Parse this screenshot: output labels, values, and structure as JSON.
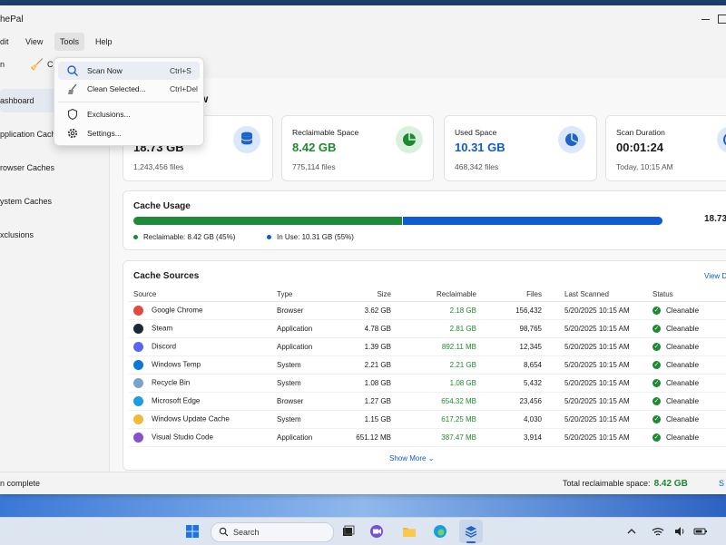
{
  "window": {
    "title": "hePal"
  },
  "menu": [
    {
      "label": "dit",
      "x": 0
    },
    {
      "label": "View",
      "x": 22
    },
    {
      "label": "Tools",
      "x": 60
    },
    {
      "label": "Help",
      "x": 99
    }
  ],
  "toolbar": {
    "item1": "n",
    "item2": "C"
  },
  "sidebar": [
    {
      "label": "ashboard",
      "active": true
    },
    {
      "label": "pplication Cache",
      "active": false
    },
    {
      "label": "rowser Caches",
      "active": false
    },
    {
      "label": "ystem Caches",
      "active": false
    },
    {
      "label": "xclusions",
      "active": false
    }
  ],
  "page_title": "w",
  "stats": [
    {
      "label": "",
      "value": "18.73 GB",
      "sub": "1,243,456 files",
      "color": "#1b1b1b",
      "icon": "database-icon"
    },
    {
      "label": "Reclaimable Space",
      "value": "8.42 GB",
      "sub": "775,114 files",
      "color": "#1c8a2f",
      "icon": "pie-chart-icon"
    },
    {
      "label": "Used Space",
      "value": "10.31 GB",
      "sub": "468,342 files",
      "color": "#0a5cd4",
      "icon": "pie-chart-icon"
    },
    {
      "label": "Scan Duration",
      "value": "00:01:24",
      "sub": "Today, 10:15 AM",
      "color": "#1b1b1b",
      "icon": "clock-icon"
    }
  ],
  "usage": {
    "title": "Cache Usage",
    "total": "18.73",
    "reclaimable_legend": "Reclaimable: 8.42 GB (45%)",
    "inuse_legend": "In Use: 10.31 GB (55%)",
    "reclaimable_fraction": 0.45
  },
  "sources": {
    "title": "Cache Sources",
    "view_details": "View D",
    "show_more": "Show More",
    "columns": [
      "Source",
      "Type",
      "Size",
      "Reclaimable",
      "Files",
      "Last Scanned",
      "Status"
    ],
    "rows": [
      {
        "source": "Google Chrome",
        "type": "Browser",
        "size": "3.62 GB",
        "reclaimable": "2.18 GB",
        "files": "156,432",
        "scanned": "5/20/2025 10:15 AM",
        "status": "Cleanable",
        "icon": "chrome-icon",
        "color": "#e24a3b"
      },
      {
        "source": "Steam",
        "type": "Application",
        "size": "4.78 GB",
        "reclaimable": "2.81 GB",
        "files": "98,765",
        "scanned": "5/20/2025 10:15 AM",
        "status": "Cleanable",
        "icon": "steam-icon",
        "color": "#1b2838"
      },
      {
        "source": "Discord",
        "type": "Application",
        "size": "1.39 GB",
        "reclaimable": "892.11 MB",
        "files": "12,345",
        "scanned": "5/20/2025 10:15 AM",
        "status": "Cleanable",
        "icon": "discord-icon",
        "color": "#5865f2"
      },
      {
        "source": "Windows Temp",
        "type": "System",
        "size": "2.21 GB",
        "reclaimable": "2.21 GB",
        "files": "8,654",
        "scanned": "5/20/2025 10:15 AM",
        "status": "Cleanable",
        "icon": "windows-icon",
        "color": "#0a78d7"
      },
      {
        "source": "Recycle Bin",
        "type": "System",
        "size": "1.08 GB",
        "reclaimable": "1.08 GB",
        "files": "5,432",
        "scanned": "5/20/2025 10:15 AM",
        "status": "Cleanable",
        "icon": "recycle-bin-icon",
        "color": "#7aa3c9"
      },
      {
        "source": "Microsoft Edge",
        "type": "Browser",
        "size": "1.27 GB",
        "reclaimable": "654.32 MB",
        "files": "23,456",
        "scanned": "5/20/2025 10:15 AM",
        "status": "Cleanable",
        "icon": "edge-icon",
        "color": "#1b9de2"
      },
      {
        "source": "Windows Update Cache",
        "type": "System",
        "size": "1.15 GB",
        "reclaimable": "617.25 MB",
        "files": "4,030",
        "scanned": "5/20/2025 10:15 AM",
        "status": "Cleanable",
        "icon": "folder-icon",
        "color": "#f3b73a"
      },
      {
        "source": "Visual Studio Code",
        "type": "Application",
        "size": "651.12 MB",
        "reclaimable": "387.47 MB",
        "files": "3,914",
        "scanned": "5/20/2025 10:15 AM",
        "status": "Cleanable",
        "icon": "vscode-icon",
        "color": "#8a4fcf"
      }
    ]
  },
  "tools_menu": [
    {
      "label": "Scan Now",
      "shortcut": "Ctrl+S",
      "icon": "search-icon",
      "highlighted": true
    },
    {
      "label": "Clean Selected...",
      "shortcut": "Ctrl+Del",
      "icon": "broom-icon",
      "highlighted": false
    },
    {
      "label": "Exclusions...",
      "shortcut": "",
      "icon": "shield-icon",
      "highlighted": false
    },
    {
      "label": "Settings...",
      "shortcut": "",
      "icon": "gear-icon",
      "highlighted": false
    }
  ],
  "status": {
    "text": "n complete",
    "total_label": "Total reclaimable space:",
    "total_value": "8.42 GB",
    "right": "S"
  },
  "taskbar": {
    "search_placeholder": "Search"
  },
  "colors": {
    "accent": "#0a5cd4",
    "green": "#1c8a2f"
  }
}
